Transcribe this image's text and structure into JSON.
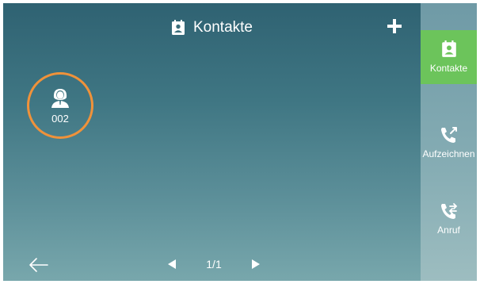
{
  "header": {
    "title": "Kontakte",
    "title_icon": "contacts-card-icon",
    "add_icon": "plus-icon"
  },
  "contacts": [
    {
      "name": "002",
      "icon": "person-avatar-icon",
      "highlight_color": "#f0923a"
    }
  ],
  "pager": {
    "text": "1/1",
    "prev_icon": "triangle-left-icon",
    "next_icon": "triangle-right-icon"
  },
  "back_icon": "arrow-left-icon",
  "sidebar": {
    "items": [
      {
        "label": "Kontakte",
        "icon": "contacts-card-icon",
        "active": true,
        "color": "#6cc45b"
      },
      {
        "label": "Aufzeichnen",
        "icon": "phone-record-icon",
        "active": false
      },
      {
        "label": "Anruf",
        "icon": "phone-transfer-icon",
        "active": false
      }
    ]
  }
}
